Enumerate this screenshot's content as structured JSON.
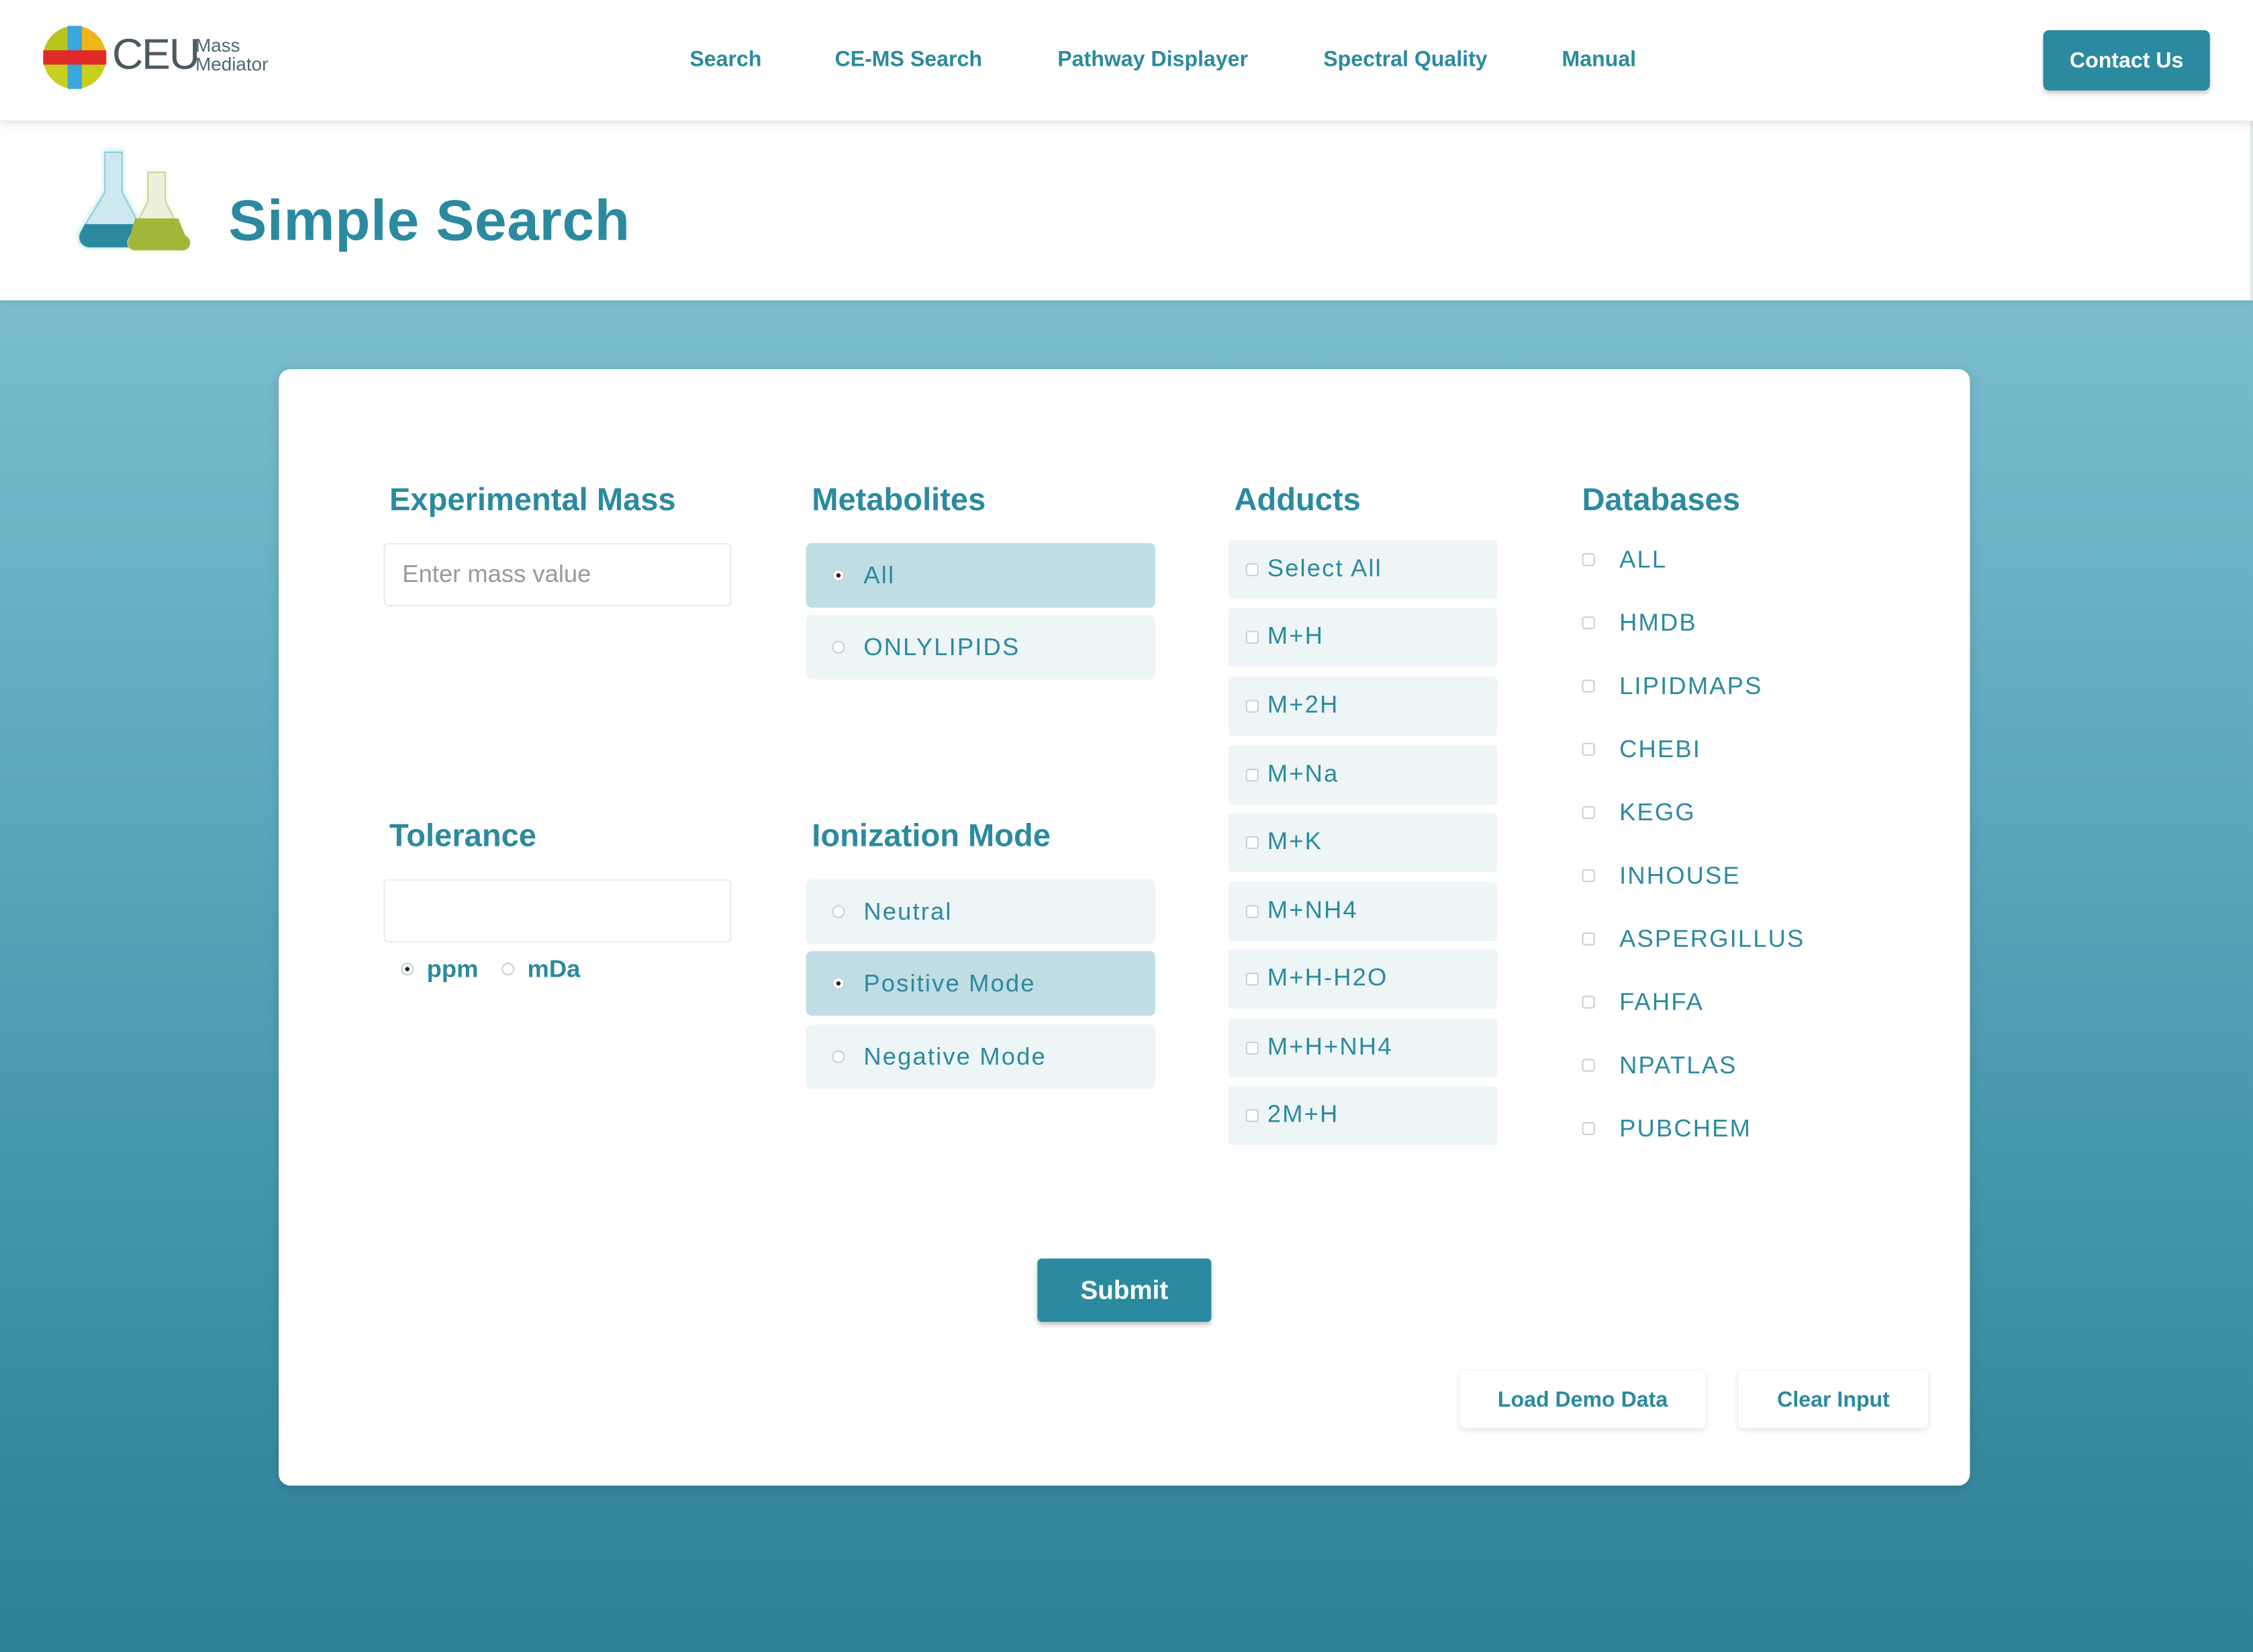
{
  "header": {
    "logo_main": "CEU",
    "logo_sub_1": "Mass",
    "logo_sub_2": "Mediator",
    "nav": [
      "Search",
      "CE-MS Search",
      "Pathway Displayer",
      "Spectral Quality",
      "Manual"
    ],
    "contact_label": "Contact Us"
  },
  "page": {
    "title": "Simple Search"
  },
  "form": {
    "experimental_mass": {
      "title": "Experimental Mass",
      "placeholder": "Enter mass value",
      "value": ""
    },
    "tolerance": {
      "title": "Tolerance",
      "value": "",
      "units": [
        {
          "label": "ppm",
          "selected": true
        },
        {
          "label": "mDa",
          "selected": false
        }
      ]
    },
    "metabolites": {
      "title": "Metabolites",
      "options": [
        {
          "label": "All",
          "selected": true
        },
        {
          "label": "ONLYLIPIDS",
          "selected": false
        }
      ]
    },
    "ionization_mode": {
      "title": "Ionization Mode",
      "options": [
        {
          "label": "Neutral",
          "selected": false
        },
        {
          "label": "Positive Mode",
          "selected": true
        },
        {
          "label": "Negative Mode",
          "selected": false
        }
      ]
    },
    "adducts": {
      "title": "Adducts",
      "options": [
        "Select All",
        "M+H",
        "M+2H",
        "M+Na",
        "M+K",
        "M+NH4",
        "M+H-H2O",
        "M+H+NH4",
        "2M+H"
      ]
    },
    "databases": {
      "title": "Databases",
      "options": [
        "ALL",
        "HMDB",
        "LIPIDMAPS",
        "CHEBI",
        "KEGG",
        "INHOUSE",
        "ASPERGILLUS",
        "FAHFA",
        "NPATLAS",
        "PUBCHEM"
      ]
    },
    "submit_label": "Submit",
    "load_demo_label": "Load Demo Data",
    "clear_label": "Clear Input"
  },
  "colors": {
    "accent": "#2b8a9f",
    "selected_option": "#c0dde3",
    "option_bg": "#eef5f7"
  }
}
